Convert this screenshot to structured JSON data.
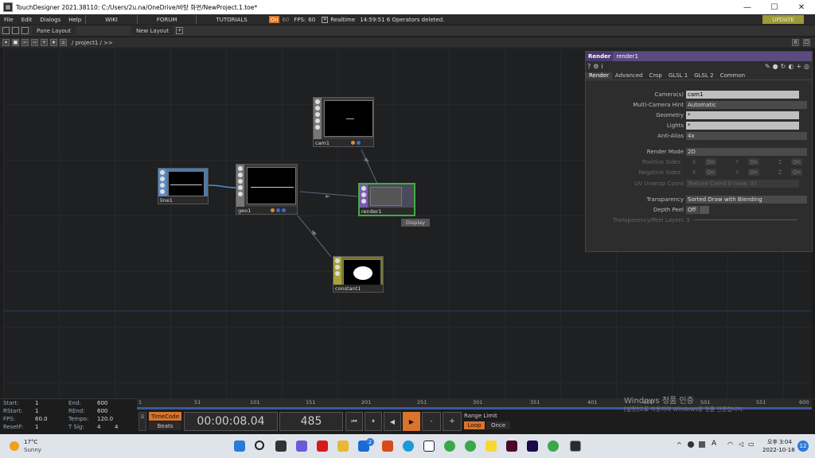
{
  "window": {
    "title": "TouchDesigner 2021.38110: C:/Users/2u.na/OneDrive/바탕 화면/NewProject.1.toe*",
    "min": "—",
    "max": "☐",
    "close": "✕"
  },
  "menu": {
    "items": [
      "File",
      "Edit",
      "Dialogs",
      "Help"
    ],
    "wiki": "WIKI",
    "forum": "FORUM",
    "tutorials": "TUTORIALS",
    "oii": "OII",
    "fps_cap": "60",
    "fps_label": "FPS:",
    "fps_value": "60",
    "realtime": "Realtime",
    "status": "14:59:51 6 Operators deleted.",
    "update": "UPDATE"
  },
  "pane": {
    "layout": "Pane Layout",
    "new_layout": "New Layout",
    "add": "+"
  },
  "path": {
    "text": "/ project1 / >>",
    "right_a": "0",
    "right_b": "☐"
  },
  "nodes": {
    "cam": "cam1",
    "line": "line1",
    "geo": "geo1",
    "render": "render1",
    "constant": "constant1",
    "display_tip": "Display"
  },
  "params": {
    "type": "Render",
    "name": "render1",
    "tabs": [
      "Render",
      "Advanced",
      "Crop",
      "GLSL 1",
      "GLSL 2",
      "Common"
    ],
    "camera_label": "Camera(s)",
    "camera_value": "cam1",
    "multicam_label": "Multi-Camera Hint",
    "multicam_value": "Automatic",
    "geometry_label": "Geometry",
    "geometry_value": "*",
    "lights_label": "Lights",
    "lights_value": "*",
    "antialias_label": "Anti-Alias",
    "antialias_value": "4x",
    "rendermode_label": "Render Mode",
    "rendermode_value": "2D",
    "possides_label": "Positive Sides",
    "negsides_label": "Negative Sides",
    "x": "X",
    "y": "Y",
    "z": "Z",
    "on": "On",
    "uvunwrap_label": "UV Unwrap Coord",
    "uvunwrap_value": "Texture Coord 0 (uvw, X)",
    "transparency_label": "Transparency",
    "transparency_value": "Sorted Draw with Blending",
    "depthpeel_label": "Depth Peel",
    "depthpeel_value": "Off",
    "peellayers_label": "Transparency/Peel Layers",
    "peellayers_value": "3"
  },
  "stats": {
    "start_l": "Start:",
    "start_v": "1",
    "end_l": "End:",
    "end_v": "600",
    "rstart_l": "RStart:",
    "rstart_v": "1",
    "rend_l": "REnd:",
    "rend_v": "600",
    "fps_l": "FPS:",
    "fps_v": "60.0",
    "tempo_l": "Tempo:",
    "tempo_v": "120.0",
    "resetf_l": "ResetF:",
    "resetf_v": "1",
    "tsig_l": "T Sig:",
    "tsig_a": "4",
    "tsig_b": "4"
  },
  "ruler": [
    "1",
    "51",
    "101",
    "151",
    "201",
    "251",
    "301",
    "351",
    "401",
    "451",
    "501",
    "551",
    "600"
  ],
  "transport": {
    "timecode": "TimeCode",
    "beats": "Beats",
    "time": "00:00:08.04",
    "frame": "485",
    "range_limit": "Range Limit",
    "loop": "Loop",
    "once": "Once",
    "minus": "-",
    "plus": "+"
  },
  "watermark": {
    "line1": "Windows 정품 인증",
    "line2": "[설정]으로 이동하여 Windows를 정품 인증합니다."
  },
  "taskbar": {
    "temp": "17°C",
    "weather": "Sunny",
    "clock_time": "오후 3:04",
    "clock_date": "2022-10-18",
    "ime": "A",
    "badge": "12",
    "notif": "2"
  },
  "colors": {
    "accent_orange": "#d9742b",
    "render_green": "#3fae3f",
    "param_header": "#5a4a80"
  }
}
